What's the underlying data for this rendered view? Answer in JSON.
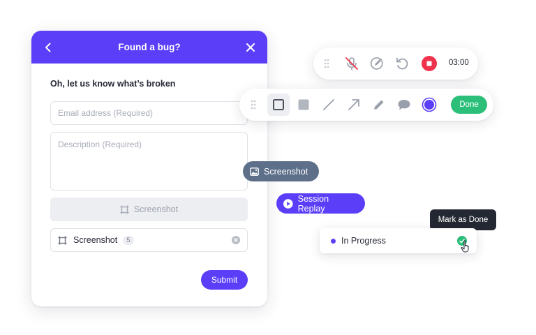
{
  "bug_form": {
    "title": "Found a bug?",
    "intro": "Oh, let us know what’s broken",
    "email_placeholder": "Email address (Required)",
    "description_placeholder": "Description (Required)",
    "screenshot_button_label": "Screenshot",
    "attachment": {
      "label": "Screenshot",
      "count": "5"
    },
    "submit_label": "Submit"
  },
  "recording_toolbar": {
    "timer": "03:00",
    "icons": [
      "drag-handle-icon",
      "mic-muted-icon",
      "annotate-icon",
      "restart-icon",
      "stop-recording-icon"
    ]
  },
  "annotation_toolbar": {
    "tools": [
      "drag-handle-icon",
      "rectangle-icon",
      "filled-rectangle-icon",
      "line-icon",
      "arrow-icon",
      "pen-icon",
      "comment-icon",
      "color-picker-icon"
    ],
    "active_tool": "rectangle-icon",
    "selected_color": "#5b3ff8",
    "done_label": "Done"
  },
  "chips": {
    "screenshot_label": "Screenshot",
    "session_replay_label": "Session Replay"
  },
  "status": {
    "tooltip": "Mark as Done",
    "label": "In Progress"
  },
  "colors": {
    "brand": "#5b3ff8",
    "success": "#2bbf7a",
    "danger": "#f0334c",
    "slate": "#5d6f89",
    "tooltip": "#242833"
  }
}
